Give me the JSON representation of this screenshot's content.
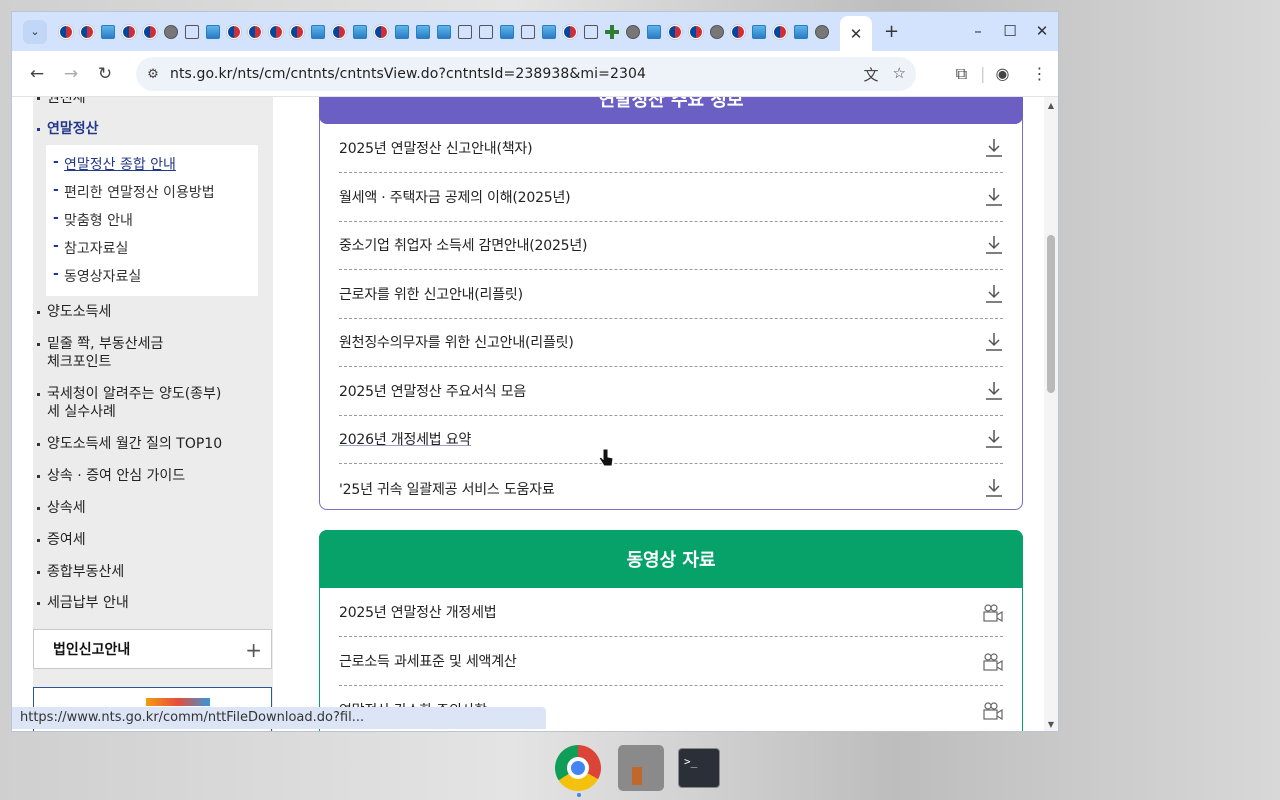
{
  "browser": {
    "active_tab_close": "✕",
    "new_tab": "+",
    "url_host": "nts.go.kr",
    "url_path": "/nts/cm/cntnts/cntntsView.do?cntntsId=238938&mi=2304",
    "status_url": "https://www.nts.go.kr/comm/nttFileDownload.do?fil..."
  },
  "sidebar": {
    "top_cut_item": "원천세",
    "active_item": "연말정산",
    "sub_items": [
      "연말정산 종합 안내",
      "편리한 연말정산 이용방법",
      "맞춤형 안내",
      "참고자료실",
      "동영상자료실"
    ],
    "items": [
      "양도소득세",
      "밑줄 쫙, 부동산세금",
      "체크포인트",
      "국세청이 알려주는 양도(종부)",
      "세 실수사례",
      "양도소득세 월간 질의 TOP10",
      "상속 · 증여 안심 가이드",
      "상속세",
      "증여세",
      "종합부동산세",
      "세금납부 안내"
    ],
    "accordion_label": "법인신고안내",
    "accordion_plus": "+"
  },
  "docs_section": {
    "title": "연말정산 주요 정보",
    "rows": [
      "2025년 연말정산 신고안내(책자)",
      "월세액 · 주택자금 공제의 이해(2025년)",
      "중소기업 취업자 소득세 감면안내(2025년)",
      "근로자를 위한 신고안내(리플릿)",
      "원천징수의무자를 위한 신고안내(리플릿)",
      "2025년 연말정산 주요서식 모음",
      "2026년 개정세법 요약",
      "'25년 귀속 일괄제공 서비스 도움자료"
    ]
  },
  "video_section": {
    "title": "동영상 자료",
    "rows": [
      "2025년 연말정산 개정세법",
      "근로소득 과세표준 및 세액계산",
      "연말정산 간소화 주의사항"
    ]
  },
  "taskbar": {
    "terminal_glyph": ">_"
  }
}
